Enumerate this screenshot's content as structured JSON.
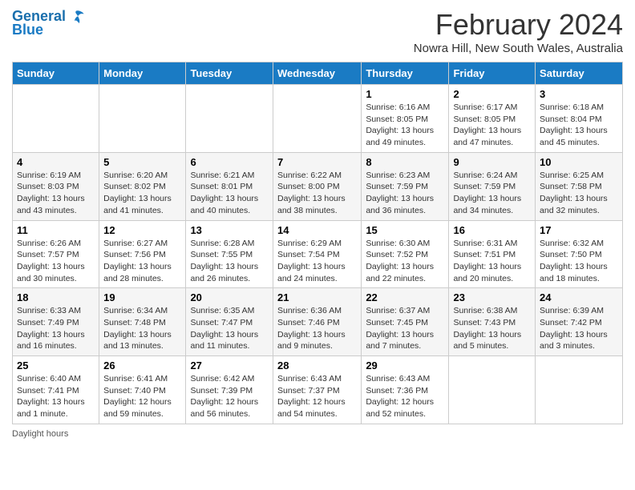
{
  "logo": {
    "line1": "General",
    "line2": "Blue"
  },
  "title": "February 2024",
  "subtitle": "Nowra Hill, New South Wales, Australia",
  "days_header": [
    "Sunday",
    "Monday",
    "Tuesday",
    "Wednesday",
    "Thursday",
    "Friday",
    "Saturday"
  ],
  "weeks": [
    [
      {
        "day": "",
        "info": ""
      },
      {
        "day": "",
        "info": ""
      },
      {
        "day": "",
        "info": ""
      },
      {
        "day": "",
        "info": ""
      },
      {
        "day": "1",
        "info": "Sunrise: 6:16 AM\nSunset: 8:05 PM\nDaylight: 13 hours and 49 minutes."
      },
      {
        "day": "2",
        "info": "Sunrise: 6:17 AM\nSunset: 8:05 PM\nDaylight: 13 hours and 47 minutes."
      },
      {
        "day": "3",
        "info": "Sunrise: 6:18 AM\nSunset: 8:04 PM\nDaylight: 13 hours and 45 minutes."
      }
    ],
    [
      {
        "day": "4",
        "info": "Sunrise: 6:19 AM\nSunset: 8:03 PM\nDaylight: 13 hours and 43 minutes."
      },
      {
        "day": "5",
        "info": "Sunrise: 6:20 AM\nSunset: 8:02 PM\nDaylight: 13 hours and 41 minutes."
      },
      {
        "day": "6",
        "info": "Sunrise: 6:21 AM\nSunset: 8:01 PM\nDaylight: 13 hours and 40 minutes."
      },
      {
        "day": "7",
        "info": "Sunrise: 6:22 AM\nSunset: 8:00 PM\nDaylight: 13 hours and 38 minutes."
      },
      {
        "day": "8",
        "info": "Sunrise: 6:23 AM\nSunset: 7:59 PM\nDaylight: 13 hours and 36 minutes."
      },
      {
        "day": "9",
        "info": "Sunrise: 6:24 AM\nSunset: 7:59 PM\nDaylight: 13 hours and 34 minutes."
      },
      {
        "day": "10",
        "info": "Sunrise: 6:25 AM\nSunset: 7:58 PM\nDaylight: 13 hours and 32 minutes."
      }
    ],
    [
      {
        "day": "11",
        "info": "Sunrise: 6:26 AM\nSunset: 7:57 PM\nDaylight: 13 hours and 30 minutes."
      },
      {
        "day": "12",
        "info": "Sunrise: 6:27 AM\nSunset: 7:56 PM\nDaylight: 13 hours and 28 minutes."
      },
      {
        "day": "13",
        "info": "Sunrise: 6:28 AM\nSunset: 7:55 PM\nDaylight: 13 hours and 26 minutes."
      },
      {
        "day": "14",
        "info": "Sunrise: 6:29 AM\nSunset: 7:54 PM\nDaylight: 13 hours and 24 minutes."
      },
      {
        "day": "15",
        "info": "Sunrise: 6:30 AM\nSunset: 7:52 PM\nDaylight: 13 hours and 22 minutes."
      },
      {
        "day": "16",
        "info": "Sunrise: 6:31 AM\nSunset: 7:51 PM\nDaylight: 13 hours and 20 minutes."
      },
      {
        "day": "17",
        "info": "Sunrise: 6:32 AM\nSunset: 7:50 PM\nDaylight: 13 hours and 18 minutes."
      }
    ],
    [
      {
        "day": "18",
        "info": "Sunrise: 6:33 AM\nSunset: 7:49 PM\nDaylight: 13 hours and 16 minutes."
      },
      {
        "day": "19",
        "info": "Sunrise: 6:34 AM\nSunset: 7:48 PM\nDaylight: 13 hours and 13 minutes."
      },
      {
        "day": "20",
        "info": "Sunrise: 6:35 AM\nSunset: 7:47 PM\nDaylight: 13 hours and 11 minutes."
      },
      {
        "day": "21",
        "info": "Sunrise: 6:36 AM\nSunset: 7:46 PM\nDaylight: 13 hours and 9 minutes."
      },
      {
        "day": "22",
        "info": "Sunrise: 6:37 AM\nSunset: 7:45 PM\nDaylight: 13 hours and 7 minutes."
      },
      {
        "day": "23",
        "info": "Sunrise: 6:38 AM\nSunset: 7:43 PM\nDaylight: 13 hours and 5 minutes."
      },
      {
        "day": "24",
        "info": "Sunrise: 6:39 AM\nSunset: 7:42 PM\nDaylight: 13 hours and 3 minutes."
      }
    ],
    [
      {
        "day": "25",
        "info": "Sunrise: 6:40 AM\nSunset: 7:41 PM\nDaylight: 13 hours and 1 minute."
      },
      {
        "day": "26",
        "info": "Sunrise: 6:41 AM\nSunset: 7:40 PM\nDaylight: 12 hours and 59 minutes."
      },
      {
        "day": "27",
        "info": "Sunrise: 6:42 AM\nSunset: 7:39 PM\nDaylight: 12 hours and 56 minutes."
      },
      {
        "day": "28",
        "info": "Sunrise: 6:43 AM\nSunset: 7:37 PM\nDaylight: 12 hours and 54 minutes."
      },
      {
        "day": "29",
        "info": "Sunrise: 6:43 AM\nSunset: 7:36 PM\nDaylight: 12 hours and 52 minutes."
      },
      {
        "day": "",
        "info": ""
      },
      {
        "day": "",
        "info": ""
      }
    ]
  ],
  "footer": "Daylight hours"
}
